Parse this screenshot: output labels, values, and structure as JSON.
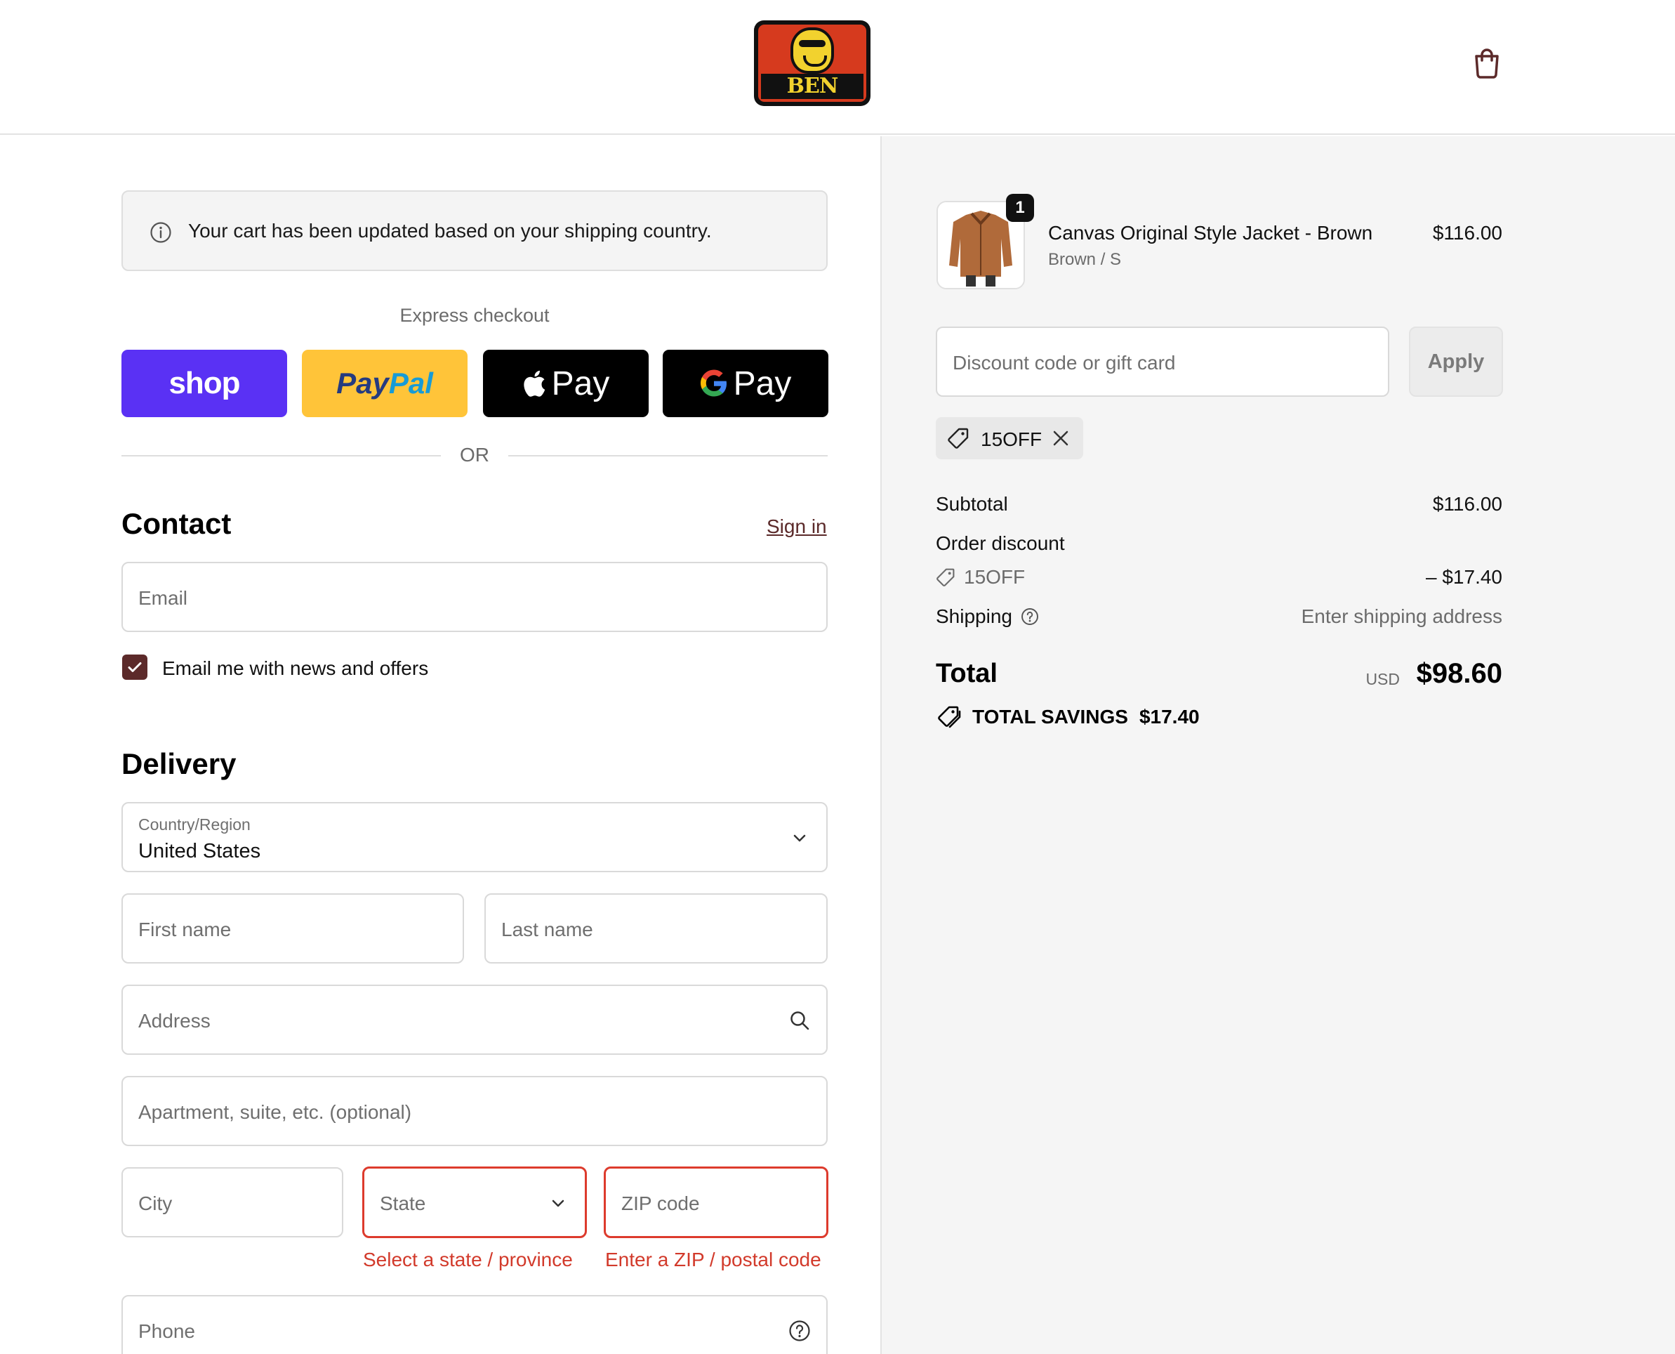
{
  "header": {
    "logo_text": "BEN DAVIS",
    "cart_icon": "shopping-bag-icon"
  },
  "notice": {
    "text": "Your cart has been updated based on your shipping country.",
    "icon": "info-icon"
  },
  "express": {
    "title": "Express checkout",
    "buttons": {
      "shop": "shop",
      "paypal_1": "Pay",
      "paypal_2": "Pal",
      "apple": "Pay",
      "google": "Pay"
    },
    "divider": "OR"
  },
  "contact": {
    "title": "Contact",
    "sign_in": "Sign in",
    "email_placeholder": "Email",
    "newsletter_label": "Email me with news and offers",
    "newsletter_checked": true
  },
  "delivery": {
    "title": "Delivery",
    "country_label": "Country/Region",
    "country_value": "United States",
    "first_name": "First name",
    "last_name": "Last name",
    "address": "Address",
    "apartment": "Apartment, suite, etc. (optional)",
    "city": "City",
    "state": "State",
    "zip": "ZIP code",
    "state_error": "Select a state / province",
    "zip_error": "Enter a ZIP / postal code",
    "phone": "Phone"
  },
  "summary": {
    "item": {
      "quantity": "1",
      "name": "Canvas Original Style Jacket - Brown",
      "variant": "Brown / S",
      "price": "$116.00"
    },
    "discount_placeholder": "Discount code or gift card",
    "apply_label": "Apply",
    "applied_code": "15OFF",
    "subtotal_label": "Subtotal",
    "subtotal_value": "$116.00",
    "order_discount_label": "Order discount",
    "discount_code": "15OFF",
    "discount_value": "– $17.40",
    "shipping_label": "Shipping",
    "shipping_value": "Enter shipping address",
    "total_label": "Total",
    "currency": "USD",
    "total_value": "$98.60",
    "savings_label": "TOTAL SAVINGS",
    "savings_value": "$17.40"
  },
  "colors": {
    "shop_pay": "#5a31f4",
    "paypal": "#ffc439",
    "accent": "#5c2a2a",
    "error": "#dd3b2d"
  }
}
